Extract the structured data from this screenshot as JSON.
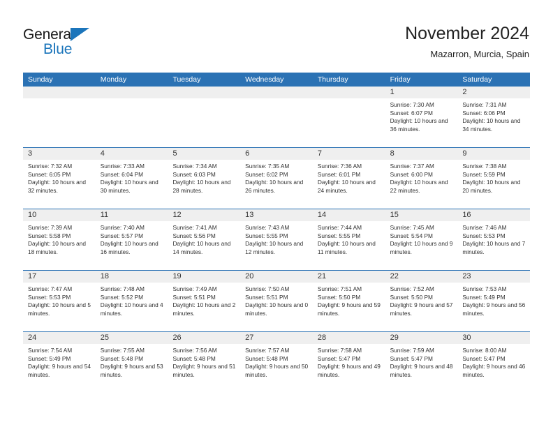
{
  "brand": {
    "name_top": "General",
    "name_bottom": "Blue",
    "accent_color": "#1b75bb"
  },
  "header": {
    "title": "November 2024",
    "subtitle": "Mazarron, Murcia, Spain"
  },
  "theme": {
    "header_blue": "#2b72b4",
    "daynum_gray": "#efefef",
    "text": "#222222"
  },
  "weekdays": [
    "Sunday",
    "Monday",
    "Tuesday",
    "Wednesday",
    "Thursday",
    "Friday",
    "Saturday"
  ],
  "weeks": [
    [
      {
        "day": "",
        "empty": true
      },
      {
        "day": "",
        "empty": true
      },
      {
        "day": "",
        "empty": true
      },
      {
        "day": "",
        "empty": true
      },
      {
        "day": "",
        "empty": true
      },
      {
        "day": "1",
        "sunrise": "Sunrise: 7:30 AM",
        "sunset": "Sunset: 6:07 PM",
        "daylight": "Daylight: 10 hours and 36 minutes."
      },
      {
        "day": "2",
        "sunrise": "Sunrise: 7:31 AM",
        "sunset": "Sunset: 6:06 PM",
        "daylight": "Daylight: 10 hours and 34 minutes."
      }
    ],
    [
      {
        "day": "3",
        "sunrise": "Sunrise: 7:32 AM",
        "sunset": "Sunset: 6:05 PM",
        "daylight": "Daylight: 10 hours and 32 minutes."
      },
      {
        "day": "4",
        "sunrise": "Sunrise: 7:33 AM",
        "sunset": "Sunset: 6:04 PM",
        "daylight": "Daylight: 10 hours and 30 minutes."
      },
      {
        "day": "5",
        "sunrise": "Sunrise: 7:34 AM",
        "sunset": "Sunset: 6:03 PM",
        "daylight": "Daylight: 10 hours and 28 minutes."
      },
      {
        "day": "6",
        "sunrise": "Sunrise: 7:35 AM",
        "sunset": "Sunset: 6:02 PM",
        "daylight": "Daylight: 10 hours and 26 minutes."
      },
      {
        "day": "7",
        "sunrise": "Sunrise: 7:36 AM",
        "sunset": "Sunset: 6:01 PM",
        "daylight": "Daylight: 10 hours and 24 minutes."
      },
      {
        "day": "8",
        "sunrise": "Sunrise: 7:37 AM",
        "sunset": "Sunset: 6:00 PM",
        "daylight": "Daylight: 10 hours and 22 minutes."
      },
      {
        "day": "9",
        "sunrise": "Sunrise: 7:38 AM",
        "sunset": "Sunset: 5:59 PM",
        "daylight": "Daylight: 10 hours and 20 minutes."
      }
    ],
    [
      {
        "day": "10",
        "sunrise": "Sunrise: 7:39 AM",
        "sunset": "Sunset: 5:58 PM",
        "daylight": "Daylight: 10 hours and 18 minutes."
      },
      {
        "day": "11",
        "sunrise": "Sunrise: 7:40 AM",
        "sunset": "Sunset: 5:57 PM",
        "daylight": "Daylight: 10 hours and 16 minutes."
      },
      {
        "day": "12",
        "sunrise": "Sunrise: 7:41 AM",
        "sunset": "Sunset: 5:56 PM",
        "daylight": "Daylight: 10 hours and 14 minutes."
      },
      {
        "day": "13",
        "sunrise": "Sunrise: 7:43 AM",
        "sunset": "Sunset: 5:55 PM",
        "daylight": "Daylight: 10 hours and 12 minutes."
      },
      {
        "day": "14",
        "sunrise": "Sunrise: 7:44 AM",
        "sunset": "Sunset: 5:55 PM",
        "daylight": "Daylight: 10 hours and 11 minutes."
      },
      {
        "day": "15",
        "sunrise": "Sunrise: 7:45 AM",
        "sunset": "Sunset: 5:54 PM",
        "daylight": "Daylight: 10 hours and 9 minutes."
      },
      {
        "day": "16",
        "sunrise": "Sunrise: 7:46 AM",
        "sunset": "Sunset: 5:53 PM",
        "daylight": "Daylight: 10 hours and 7 minutes."
      }
    ],
    [
      {
        "day": "17",
        "sunrise": "Sunrise: 7:47 AM",
        "sunset": "Sunset: 5:53 PM",
        "daylight": "Daylight: 10 hours and 5 minutes."
      },
      {
        "day": "18",
        "sunrise": "Sunrise: 7:48 AM",
        "sunset": "Sunset: 5:52 PM",
        "daylight": "Daylight: 10 hours and 4 minutes."
      },
      {
        "day": "19",
        "sunrise": "Sunrise: 7:49 AM",
        "sunset": "Sunset: 5:51 PM",
        "daylight": "Daylight: 10 hours and 2 minutes."
      },
      {
        "day": "20",
        "sunrise": "Sunrise: 7:50 AM",
        "sunset": "Sunset: 5:51 PM",
        "daylight": "Daylight: 10 hours and 0 minutes."
      },
      {
        "day": "21",
        "sunrise": "Sunrise: 7:51 AM",
        "sunset": "Sunset: 5:50 PM",
        "daylight": "Daylight: 9 hours and 59 minutes."
      },
      {
        "day": "22",
        "sunrise": "Sunrise: 7:52 AM",
        "sunset": "Sunset: 5:50 PM",
        "daylight": "Daylight: 9 hours and 57 minutes."
      },
      {
        "day": "23",
        "sunrise": "Sunrise: 7:53 AM",
        "sunset": "Sunset: 5:49 PM",
        "daylight": "Daylight: 9 hours and 56 minutes."
      }
    ],
    [
      {
        "day": "24",
        "sunrise": "Sunrise: 7:54 AM",
        "sunset": "Sunset: 5:49 PM",
        "daylight": "Daylight: 9 hours and 54 minutes."
      },
      {
        "day": "25",
        "sunrise": "Sunrise: 7:55 AM",
        "sunset": "Sunset: 5:48 PM",
        "daylight": "Daylight: 9 hours and 53 minutes."
      },
      {
        "day": "26",
        "sunrise": "Sunrise: 7:56 AM",
        "sunset": "Sunset: 5:48 PM",
        "daylight": "Daylight: 9 hours and 51 minutes."
      },
      {
        "day": "27",
        "sunrise": "Sunrise: 7:57 AM",
        "sunset": "Sunset: 5:48 PM",
        "daylight": "Daylight: 9 hours and 50 minutes."
      },
      {
        "day": "28",
        "sunrise": "Sunrise: 7:58 AM",
        "sunset": "Sunset: 5:47 PM",
        "daylight": "Daylight: 9 hours and 49 minutes."
      },
      {
        "day": "29",
        "sunrise": "Sunrise: 7:59 AM",
        "sunset": "Sunset: 5:47 PM",
        "daylight": "Daylight: 9 hours and 48 minutes."
      },
      {
        "day": "30",
        "sunrise": "Sunrise: 8:00 AM",
        "sunset": "Sunset: 5:47 PM",
        "daylight": "Daylight: 9 hours and 46 minutes."
      }
    ]
  ]
}
